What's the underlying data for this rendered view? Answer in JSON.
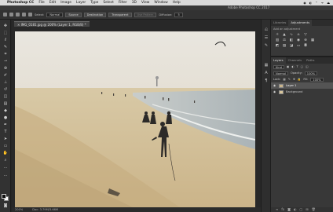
{
  "menubar": {
    "apple": "",
    "app_name": "Photoshop CC",
    "items": [
      "File",
      "Edit",
      "Image",
      "Layer",
      "Type",
      "Select",
      "Filter",
      "3D",
      "View",
      "Window",
      "Help"
    ],
    "status": [
      "◉",
      "◐",
      "⌃",
      "ᯤ",
      "⏏"
    ]
  },
  "app_title": "Adobe Photoshop CC 2017",
  "options": {
    "mode_label": "Select:",
    "mode_value": "Normal",
    "source_label": "Source",
    "destination_label": "Destination",
    "transparent_label": "Transparent",
    "use_pattern_label": "Use Pattern",
    "diffusion_label": "Diffusion:",
    "diffusion_value": "5"
  },
  "document": {
    "tab_title": "IMG_0181.jpg @ 200% (Layer 1, RGB/8) *"
  },
  "status": {
    "zoom": "200%",
    "doc_size": "Doc: 3.79M/3.66M"
  },
  "panels": {
    "top_tabs": [
      "Libraries",
      "Adjustments"
    ],
    "adjust_hint": "Add an adjustment",
    "layer_tabs": [
      "Layers",
      "Channels",
      "Paths"
    ],
    "kind_label": "Kind",
    "blend_mode": "Normal",
    "opacity_label": "Opacity:",
    "opacity_value": "100%",
    "lock_label": "Lock:",
    "fill_label": "Fill:",
    "fill_value": "100%",
    "layers": [
      {
        "name": "Layer 1",
        "selected": true
      },
      {
        "name": "Background",
        "selected": false
      }
    ],
    "footer_icons": [
      "∞",
      "fx",
      "◙",
      "◐",
      "▢",
      "⊞",
      "🗑"
    ]
  },
  "colors": {
    "accent": "#1473e6",
    "foreground_swatch": "#111111",
    "background_swatch": "#ffffff"
  }
}
